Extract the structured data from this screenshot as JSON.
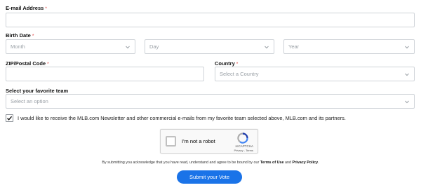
{
  "email": {
    "label": "E-mail Address",
    "required_mark": "*",
    "value": ""
  },
  "birth_date": {
    "label": "Birth Date",
    "required_mark": "*",
    "month_placeholder": "Month",
    "day_placeholder": "Day",
    "year_placeholder": "Year"
  },
  "zip": {
    "label": "ZIP/Postal Code",
    "required_mark": "*",
    "value": ""
  },
  "country": {
    "label": "Country",
    "required_mark": "*",
    "placeholder": "Select a Country"
  },
  "team": {
    "label": "Select your favorite team",
    "placeholder": "Select an option"
  },
  "consent": {
    "checked": true,
    "text": "I would like to receive the MLB.com Newsletter and other commercial e-mails from my favorite team selected above, MLB.com and its partners."
  },
  "recaptcha": {
    "label": "I'm not a robot",
    "brand": "reCAPTCHA",
    "privacy": "Privacy",
    "separator": "-",
    "terms": "Terms",
    "icon": "recaptcha-logo-icon"
  },
  "disclaimer": {
    "prefix": "By submitting you acknowledge that you have read, understand and agree to be bound by our ",
    "terms": "Terms of Use",
    "middle": " and ",
    "privacy": "Privacy Policy",
    "suffix": "."
  },
  "submit": {
    "label": "Submit your Vote"
  },
  "colors": {
    "button": "#1a73e8",
    "required": "#dd3333",
    "border": "#cfd3d8"
  }
}
